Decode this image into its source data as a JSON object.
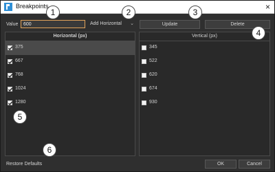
{
  "window": {
    "title": "Breakpoints",
    "close_icon": "×"
  },
  "toolbar": {
    "value_label": "Value",
    "value": "600",
    "dropdown_value": "Add Horizontal",
    "update_label": "Update",
    "delete_label": "Delete"
  },
  "horizontal": {
    "header": "Horizontal (px)",
    "items": [
      {
        "value": "375",
        "checked": true,
        "selected": true
      },
      {
        "value": "667",
        "checked": true,
        "selected": false
      },
      {
        "value": "768",
        "checked": true,
        "selected": false
      },
      {
        "value": "1024",
        "checked": true,
        "selected": false
      },
      {
        "value": "1280",
        "checked": true,
        "selected": false
      }
    ]
  },
  "vertical": {
    "header": "Vertical (px)",
    "items": [
      {
        "value": "345",
        "checked": false
      },
      {
        "value": "522",
        "checked": false
      },
      {
        "value": "620",
        "checked": false
      },
      {
        "value": "674",
        "checked": false
      },
      {
        "value": "930",
        "checked": false
      }
    ]
  },
  "footer": {
    "restore_label": "Restore Defaults",
    "ok_label": "OK",
    "cancel_label": "Cancel"
  },
  "callouts": [
    "1",
    "2",
    "3",
    "4",
    "5",
    "6"
  ],
  "colors": {
    "accent_input_border": "#e3a45a",
    "background": "#2f2f2f",
    "callout_fill": "#ffffff"
  }
}
